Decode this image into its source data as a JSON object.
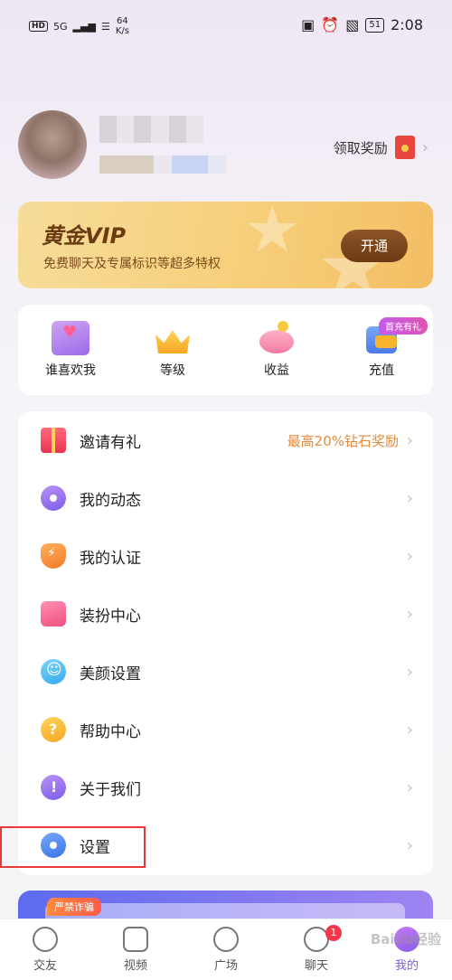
{
  "status_bar": {
    "hd": "HD",
    "signal": "5G",
    "speed_value": "64",
    "speed_unit": "K/s",
    "battery": "51",
    "time": "2:08"
  },
  "profile": {
    "reward_label": "领取奖励"
  },
  "vip": {
    "title": "黄金VIP",
    "desc": "免费聊天及专属标识等超多特权",
    "button": "开通"
  },
  "quick_actions": [
    {
      "label": "谁喜欢我",
      "icon": "heart-envelope-icon"
    },
    {
      "label": "等级",
      "icon": "crown-icon"
    },
    {
      "label": "收益",
      "icon": "piggy-bank-icon"
    },
    {
      "label": "充值",
      "icon": "wallet-icon",
      "badge": "首充有礼"
    }
  ],
  "menu": [
    {
      "label": "邀请有礼",
      "extra": "最高20%钻石奖励",
      "icon": "gift-icon"
    },
    {
      "label": "我的动态",
      "icon": "moments-icon"
    },
    {
      "label": "我的认证",
      "icon": "verification-icon"
    },
    {
      "label": "装扮中心",
      "icon": "dress-icon"
    },
    {
      "label": "美颜设置",
      "icon": "beauty-icon"
    },
    {
      "label": "帮助中心",
      "icon": "help-icon"
    },
    {
      "label": "关于我们",
      "icon": "about-icon"
    },
    {
      "label": "设置",
      "icon": "settings-icon"
    }
  ],
  "banner": {
    "tag": "严禁诈骗"
  },
  "tabs": [
    {
      "label": "交友",
      "icon": "heart-tab-icon"
    },
    {
      "label": "视频",
      "icon": "video-tab-icon"
    },
    {
      "label": "广场",
      "icon": "compass-tab-icon"
    },
    {
      "label": "聊天",
      "icon": "chat-tab-icon",
      "badge": "1"
    },
    {
      "label": "我的",
      "icon": "me-tab-icon",
      "active": true
    }
  ],
  "watermark": "Baidu经验",
  "colors": {
    "accent": "#7f5ce6",
    "vip_gold": "#f6cf7a",
    "highlight_red": "#e83a3a",
    "reward_orange": "#e58a3c"
  }
}
